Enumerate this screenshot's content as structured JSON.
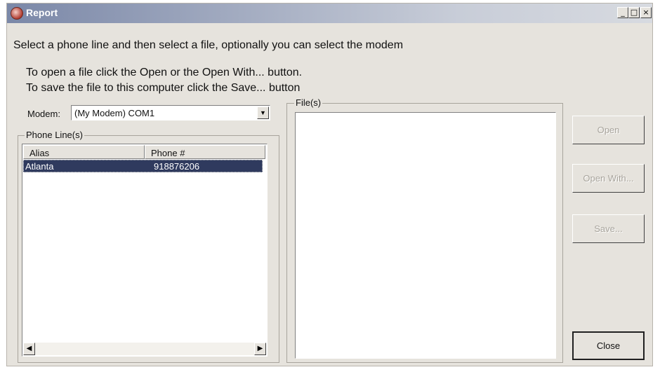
{
  "window": {
    "title": "Report",
    "icons": [
      "app-icon",
      "minimize-icon",
      "maximize-icon",
      "close-icon"
    ]
  },
  "instructions": {
    "line1": "Select a phone line and then select a file, optionally you can select the modem",
    "line2": "To open a file click the Open or the Open With... button.",
    "line3": "To save the file to this computer click the Save... button"
  },
  "modem": {
    "label": "Modem:",
    "selected": "(My Modem) COM1"
  },
  "phone_lines": {
    "group_label": "Phone Line(s)",
    "columns": [
      "Alias",
      "Phone #"
    ],
    "rows": [
      {
        "alias": "Atlanta",
        "phone": "918876206",
        "selected": true
      }
    ]
  },
  "files": {
    "group_label": "File(s)",
    "items": []
  },
  "buttons": {
    "open": "Open",
    "open_with": "Open With...",
    "save": "Save...",
    "close": "Close"
  },
  "colors": {
    "selection": "#2f3a5e",
    "window_bg": "#e6e3dd"
  }
}
